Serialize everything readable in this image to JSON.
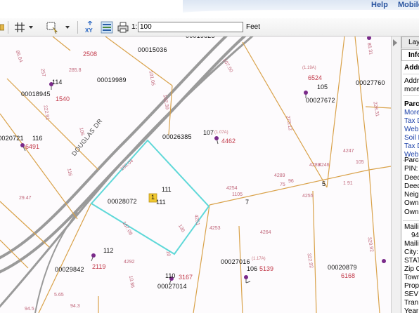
{
  "header": {
    "links": [
      {
        "label": "Help"
      },
      {
        "label": "Mobile"
      }
    ]
  },
  "toolbar": {
    "scale_prefix": "1:",
    "scale_value": "100",
    "scale_unit": "Feet",
    "xy_label": "XY"
  },
  "map": {
    "road_label": "DOUGLAS DR",
    "parcels": [
      {
        "id": "00019625"
      },
      {
        "id": "00015036"
      },
      {
        "id": "00019989"
      },
      {
        "id": "00018945"
      },
      {
        "id": "00020721"
      },
      {
        "id": "00026385"
      },
      {
        "id": "00027672"
      },
      {
        "id": "00027760"
      },
      {
        "id": "00028072"
      },
      {
        "id": "00029842"
      },
      {
        "id": "00027014"
      },
      {
        "id": "00027016"
      },
      {
        "id": "00020879"
      }
    ],
    "lot_numbers": [
      "114",
      "116",
      "107",
      "105",
      "111",
      "111",
      "112",
      "110",
      "106",
      "7",
      "5",
      "1"
    ],
    "addresses": [
      "2508",
      "1540",
      "6491",
      "4462",
      "6524",
      "2119",
      "3167",
      "5139",
      "6168",
      "7"
    ],
    "acreage": [
      "(1.07A)",
      "(1.19A)",
      "(1.17A)"
    ],
    "dims": [
      "257",
      "285.8",
      "85.04",
      "222.91",
      "105",
      "116",
      "29.47",
      "101.05",
      "102.39",
      "107.50",
      "273.12",
      "86.31",
      "228.31",
      "105",
      "4289",
      "4289",
      "4254",
      "4246",
      "4247",
      "4251",
      "4253",
      "1105",
      "75",
      "96",
      "1 91",
      "160.04",
      "167.08",
      "136",
      "4292",
      "4264",
      "10",
      "94.5",
      "5.65",
      "94.3",
      "10.86",
      "320.92",
      "322.92",
      "4255"
    ]
  },
  "panel": {
    "tabs": [
      {
        "label": "Layers"
      },
      {
        "label": "Info"
      }
    ],
    "section_address": "Address",
    "address_lines": [
      "Address",
      "more"
    ],
    "section_parcel": "Parcel",
    "links": [
      "More",
      "Tax D",
      "Web",
      "Soil I",
      "Tax D",
      "Web"
    ],
    "fields": [
      "Parc",
      "PIN:",
      "Deed",
      "Deed",
      "Neigh",
      "Own",
      "Own"
    ],
    "mailing": [
      "Maili",
      "94",
      "Maili",
      "City:",
      "STAT",
      "Zip C",
      "Town",
      "Prop",
      "SEV",
      "Tran",
      "Year"
    ]
  },
  "colors": {
    "parcel_line": "#d9a24a",
    "selected_outline": "#5fd8d8",
    "road_gray": "#8c8c8c",
    "pin": "#7a2a8a",
    "label_red": "#c23a4a",
    "accent_blue": "#2a55a0"
  }
}
